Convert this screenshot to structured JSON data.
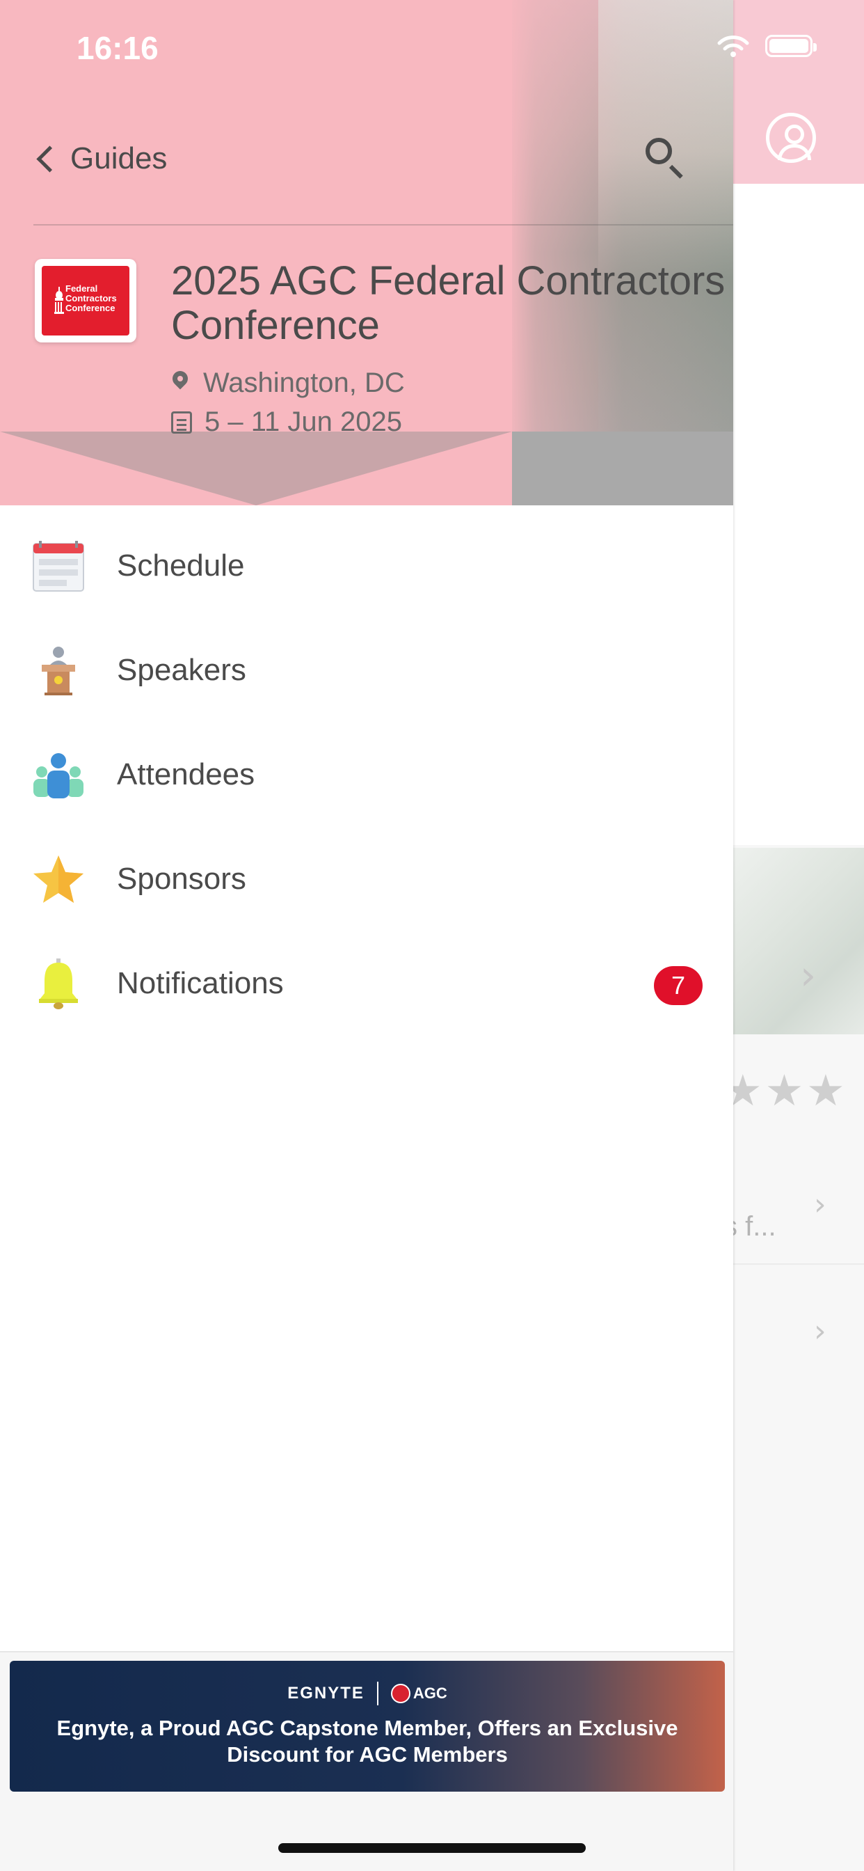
{
  "status_bar": {
    "time": "16:16"
  },
  "header": {
    "back_label": "Guides",
    "event_title": "2025 AGC Federal Contractors Conference",
    "location": "Washington, DC",
    "dates": "5 – 11 Jun 2025",
    "logo_text_lines": [
      "Federal",
      "Contractors",
      "Conference"
    ]
  },
  "menu": [
    {
      "label": "Schedule",
      "icon": "calendar-icon"
    },
    {
      "label": "Speakers",
      "icon": "podium-icon"
    },
    {
      "label": "Attendees",
      "icon": "people-icon"
    },
    {
      "label": "Sponsors",
      "icon": "star-icon"
    },
    {
      "label": "Notifications",
      "icon": "bell-icon",
      "badge": "7"
    }
  ],
  "banner": {
    "brand_left": "EGNYTE",
    "brand_right": "AGC",
    "text": "Egnyte, a Proud AGC Capstone Member, Offers an Exclusive Discount for AGC Members"
  },
  "background_app": {
    "snippet": "s f..."
  },
  "colors": {
    "header_pink": "#f8b8c0",
    "badge_red": "#e0102a",
    "logo_red": "#e31e2d",
    "banner_navy": "#13294c"
  }
}
